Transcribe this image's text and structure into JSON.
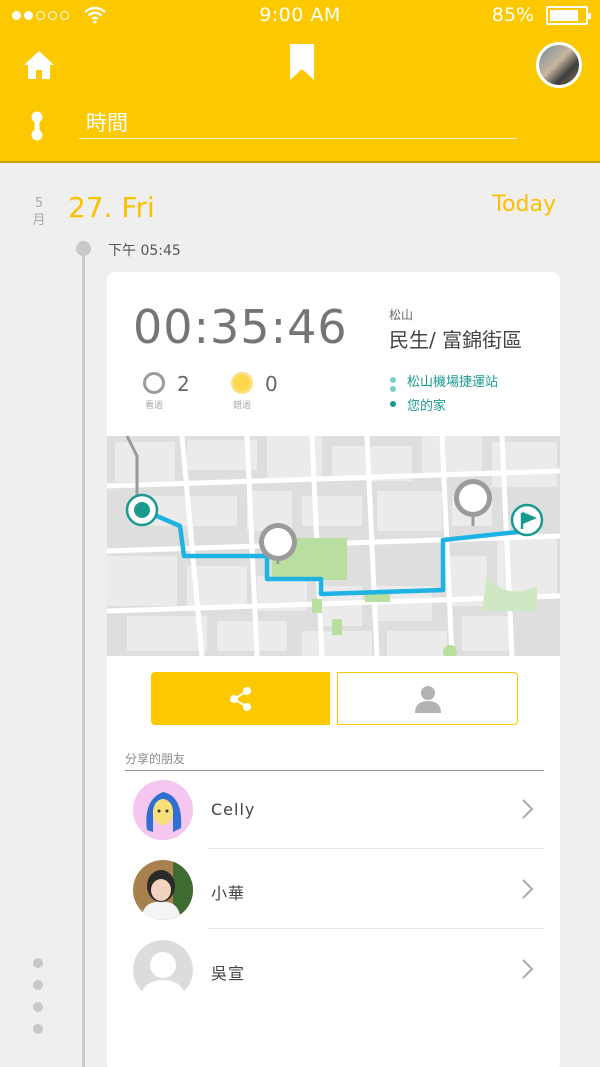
{
  "status_bar": {
    "time": "9:00  AM",
    "battery": "85%",
    "battery_level": 0.85
  },
  "header": {
    "icons": {
      "home": "home-icon",
      "bookmark": "bookmark-icon",
      "route": "route-icon"
    },
    "search_value": "時間"
  },
  "date": {
    "month": "5月",
    "day": "27. Fri",
    "today_label": "Today"
  },
  "entry": {
    "time": "下午 05:45"
  },
  "card": {
    "duration": "00:35:46",
    "seen_count": "2",
    "seen_label": "看過",
    "passed_count": "0",
    "passed_label": "錯過",
    "area": "松山",
    "district": "民生/ 富錦街區",
    "stops": [
      "松山機場捷運站",
      "您的家"
    ]
  },
  "colors": {
    "accent": "#fcc800",
    "teal": "#1a9a8e",
    "route": "#1fb3e3"
  },
  "friends": {
    "title": "分享的朋友",
    "list": [
      {
        "name": "Celly"
      },
      {
        "name": "小華"
      },
      {
        "name": "吳宣"
      }
    ]
  }
}
